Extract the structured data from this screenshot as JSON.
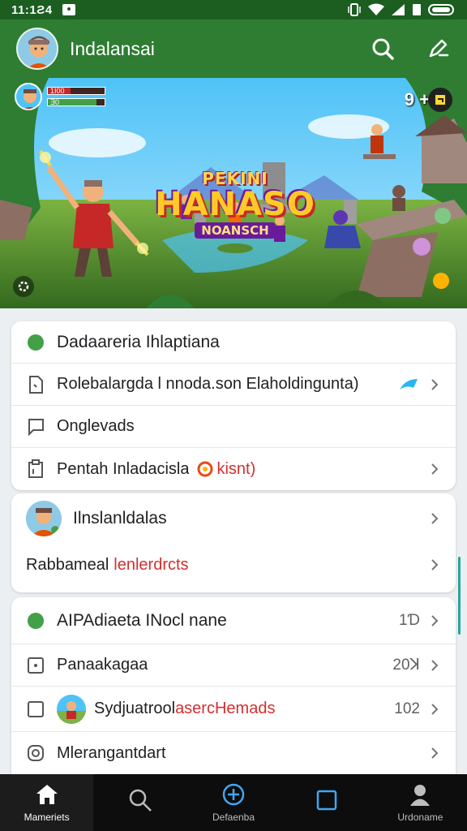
{
  "status_bar": {
    "time": "11:1Ƨ4"
  },
  "app_bar": {
    "title": "Indalansai"
  },
  "banner": {
    "logo_top": "PEKINI",
    "logo_main": "HANASO",
    "logo_sub": "NOANSCH",
    "hud_line1": "1I00",
    "hud_line2": "Ǝ0",
    "count": "9 +"
  },
  "card1": {
    "header": "Dadaareria Ihlaptiana",
    "row1": "Rolebalargda l nnoda.son Elaholdingunta)",
    "row2": "Onglevads",
    "row3_text": "Pentah Inladacisla",
    "row3_highlight": "kisnt)"
  },
  "card2": {
    "header": "Ilnslanldalas",
    "row1_prefix": "Rabbameal",
    "row1_highlight": "lenlerdrcts"
  },
  "card3": {
    "header": "AIPAdiaeta INocl nane",
    "header_value": "1Ɗ",
    "row1_label": "Panaakagaa",
    "row1_value": "20ꓘ",
    "row2_prefix": "Sydjuatrool",
    "row2_highlight": "asercHemads",
    "row2_value": "102",
    "row3_label": "Mlerangantdart"
  },
  "bottom_nav": [
    {
      "label": "Mameriets",
      "icon": "home-icon"
    },
    {
      "label": "",
      "icon": "search-icon"
    },
    {
      "label": "Defaenba",
      "icon": "add-circle-icon"
    },
    {
      "label": "",
      "icon": "square-icon"
    },
    {
      "label": "Urdoname",
      "icon": "profile-icon"
    }
  ],
  "colors": {
    "primary": "#2e7d32",
    "status": "#1b5e20",
    "accent": "#d32f2f",
    "nav_bg": "#0d0d0d"
  }
}
